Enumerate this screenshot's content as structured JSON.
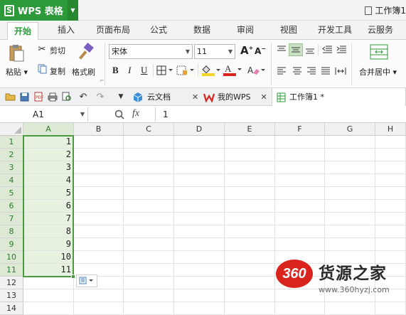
{
  "app": {
    "name": "WPS 表格",
    "workbook_title": "工作簿1"
  },
  "menu_tabs": [
    "开始",
    "插入",
    "页面布局",
    "公式",
    "数据",
    "审阅",
    "视图",
    "开发工具",
    "云服务"
  ],
  "ribbon": {
    "cut": "剪切",
    "paste": "粘贴",
    "copy": "复制",
    "format_painter": "格式刷",
    "font_name": "宋体",
    "font_size": "11",
    "bold": "B",
    "italic": "I",
    "underline": "U",
    "merge_center": "合并居中"
  },
  "doc_tabs": {
    "cloud": "云文档",
    "my_wps": "我的WPS",
    "workbook": "工作簿1 *"
  },
  "formula_bar": {
    "name_box": "A1",
    "fx": "fx",
    "value": "1"
  },
  "columns": [
    "A",
    "B",
    "C",
    "D",
    "E",
    "F",
    "G",
    "H"
  ],
  "rows": [
    "1",
    "2",
    "3",
    "4",
    "5",
    "6",
    "7",
    "8",
    "9",
    "10",
    "11",
    "12",
    "13",
    "14"
  ],
  "col_a_values": [
    "1",
    "2",
    "3",
    "4",
    "5",
    "6",
    "7",
    "8",
    "9",
    "10",
    "11"
  ],
  "selection": "A1:A11",
  "watermark": {
    "logo": "360",
    "brand": "货源之家",
    "url": "www.360hyzj.com"
  },
  "colors": {
    "accent": "#2d9a3a",
    "selection": "#4a9a3e",
    "logo_red": "#d8241c"
  }
}
